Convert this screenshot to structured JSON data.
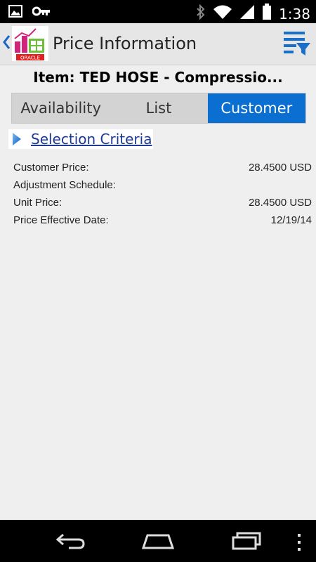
{
  "status_bar": {
    "time": "1:38",
    "left_icons": [
      "image-icon",
      "key-icon"
    ],
    "right_icons": [
      "bluetooth-icon",
      "wifi-icon",
      "signal-icon",
      "battery-icon"
    ]
  },
  "action_bar": {
    "title": "Price Information",
    "logo_text": "ORACLE"
  },
  "item_header": "Item: TED HOSE - Compressio...",
  "segments": {
    "items": [
      "Availability",
      "List",
      "Customer"
    ],
    "selected": "Customer"
  },
  "selection_criteria": {
    "label": "Selection Criteria"
  },
  "price_rows": [
    {
      "label": "Customer Price:",
      "value": "28.4500 USD"
    },
    {
      "label": "Adjustment Schedule:",
      "value": ""
    },
    {
      "label": "Unit Price:",
      "value": "28.4500 USD"
    },
    {
      "label": "Price Effective Date:",
      "value": "12/19/14"
    }
  ],
  "nav_bar": {
    "buttons": [
      "back-icon",
      "home-icon",
      "recents-icon",
      "menu-icon"
    ]
  },
  "colors": {
    "accent": "#0a6fd1",
    "link": "#1f3a93",
    "background": "#efefef"
  }
}
